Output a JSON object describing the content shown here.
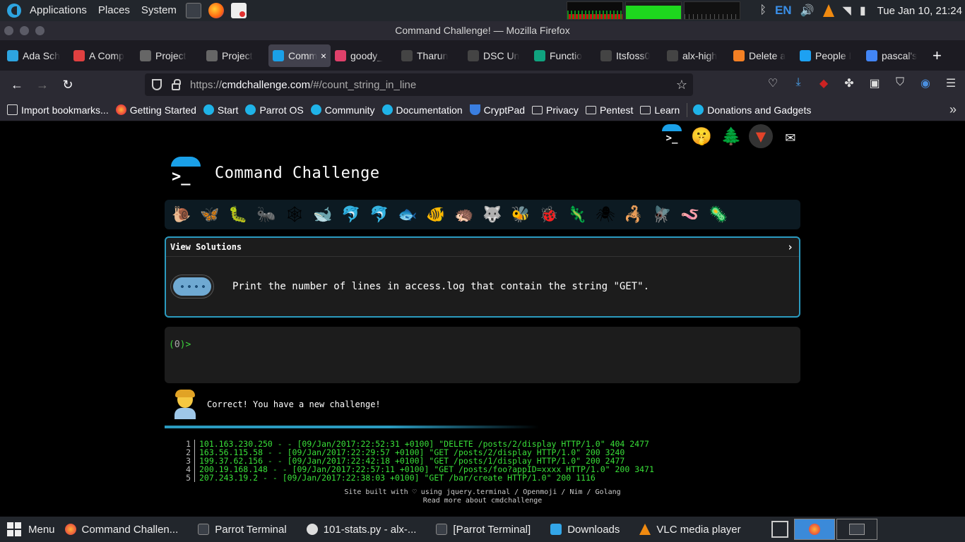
{
  "system_panel": {
    "applications": "Applications",
    "places": "Places",
    "system": "System",
    "lang": "EN",
    "clock": "Tue Jan 10, 21:24"
  },
  "window_title": "Command Challenge! — Mozilla Firefox",
  "tabs": [
    {
      "label": "Ada Sch",
      "icon": "ada-icon",
      "color": "#2da4e0"
    },
    {
      "label": "A Comp",
      "icon": "asterisk-icon",
      "color": "#e04040"
    },
    {
      "label": "Project",
      "icon": "alx-icon",
      "color": "#666666"
    },
    {
      "label": "Project",
      "icon": "alx-icon",
      "color": "#666666"
    },
    {
      "label": "Comm",
      "icon": "terminal-icon",
      "color": "#1aa0e8",
      "active": true
    },
    {
      "label": "goody_",
      "icon": "git-icon",
      "color": "#e0406a"
    },
    {
      "label": "Tharun",
      "icon": "github-icon",
      "color": "#444444"
    },
    {
      "label": "DSC Un",
      "icon": "check-icon",
      "color": "#444444"
    },
    {
      "label": "Functio",
      "icon": "openai-icon",
      "color": "#10a37f"
    },
    {
      "label": "Itsfoss0",
      "icon": "github-icon",
      "color": "#444444"
    },
    {
      "label": "alx-high",
      "icon": "github-icon",
      "color": "#444444"
    },
    {
      "label": "Delete a",
      "icon": "stackoverflow-icon",
      "color": "#f48024"
    },
    {
      "label": "People I",
      "icon": "twitter-icon",
      "color": "#1da1f2"
    },
    {
      "label": "pascal's",
      "icon": "google-icon",
      "color": "#4285f4"
    }
  ],
  "url": {
    "prefix": "https://",
    "host": "cmdchallenge.com",
    "path": "/#/count_string_in_line"
  },
  "bookmarks": [
    {
      "label": "Import bookmarks...",
      "icon": "imp"
    },
    {
      "label": "Getting Started",
      "icon": "ff"
    },
    {
      "label": "Start",
      "icon": "parrot"
    },
    {
      "label": "Parrot OS",
      "icon": "parrot"
    },
    {
      "label": "Community",
      "icon": "parrot"
    },
    {
      "label": "Documentation",
      "icon": "parrot"
    },
    {
      "label": "CryptPad",
      "icon": "shield"
    },
    {
      "label": "Privacy",
      "icon": "folder"
    },
    {
      "label": "Pentest",
      "icon": "folder"
    },
    {
      "label": "Learn",
      "icon": "folder"
    },
    {
      "label": "Donations and Gadgets",
      "icon": "parrot"
    }
  ],
  "page": {
    "title": "Command Challenge",
    "logo_prompt": ">_",
    "levels": [
      "🐌",
      "🦋",
      "🐛",
      "🐜",
      "🕸",
      "🐋",
      "🐬",
      "🐬",
      "🐟",
      "🐠",
      "🦔",
      "🐺",
      "🐝",
      "🐞",
      "🦎",
      "🕷",
      "🦂",
      "🪰",
      "🪱",
      "🦠"
    ],
    "view_solutions": "View Solutions",
    "chevron": "›",
    "challenge_text": "Print the number of lines in access.log that contain the string \"GET\".",
    "prompt_prefix": "(",
    "prompt_zero": "0",
    "prompt_suffix": ")>",
    "feedback": "Correct! You have a new challenge!",
    "log_lines": [
      {
        "n": "1",
        "text": "101.163.230.250 - - [09/Jan/2017:22:52:31 +0100] \"DELETE /posts/2/display HTTP/1.0\" 404 2477"
      },
      {
        "n": "2",
        "text": "163.56.115.58 - - [09/Jan/2017:22:29:57 +0100] \"GET /posts/2/display HTTP/1.0\" 200 3240"
      },
      {
        "n": "3",
        "text": "199.37.62.156 - - [09/Jan/2017:22:42:18 +0100] \"GET /posts/1/display HTTP/1.0\" 200 2477"
      },
      {
        "n": "4",
        "text": "200.19.168.148 - - [09/Jan/2017:22:57:11 +0100] \"GET /posts/foo?appID=xxxx HTTP/1.0\" 200 3471"
      },
      {
        "n": "5",
        "text": "207.243.19.2 - - [09/Jan/2017:22:38:03 +0100] \"GET /bar/create HTTP/1.0\" 200 1116"
      }
    ],
    "footer_line1": "Site built with ♡ using jquery.terminal / Openmoji / Nim / Golang",
    "footer_line2": "Read more about cmdchallenge"
  },
  "taskbar": {
    "menu": "Menu",
    "items": [
      {
        "label": "Command Challen...",
        "icon": "ff"
      },
      {
        "label": "Parrot Terminal",
        "icon": "term"
      },
      {
        "label": "101-stats.py - alx-...",
        "icon": "py"
      },
      {
        "label": "[Parrot Terminal]",
        "icon": "term"
      },
      {
        "label": "Downloads",
        "icon": "folder"
      },
      {
        "label": "VLC media player",
        "icon": "vlc"
      }
    ]
  }
}
